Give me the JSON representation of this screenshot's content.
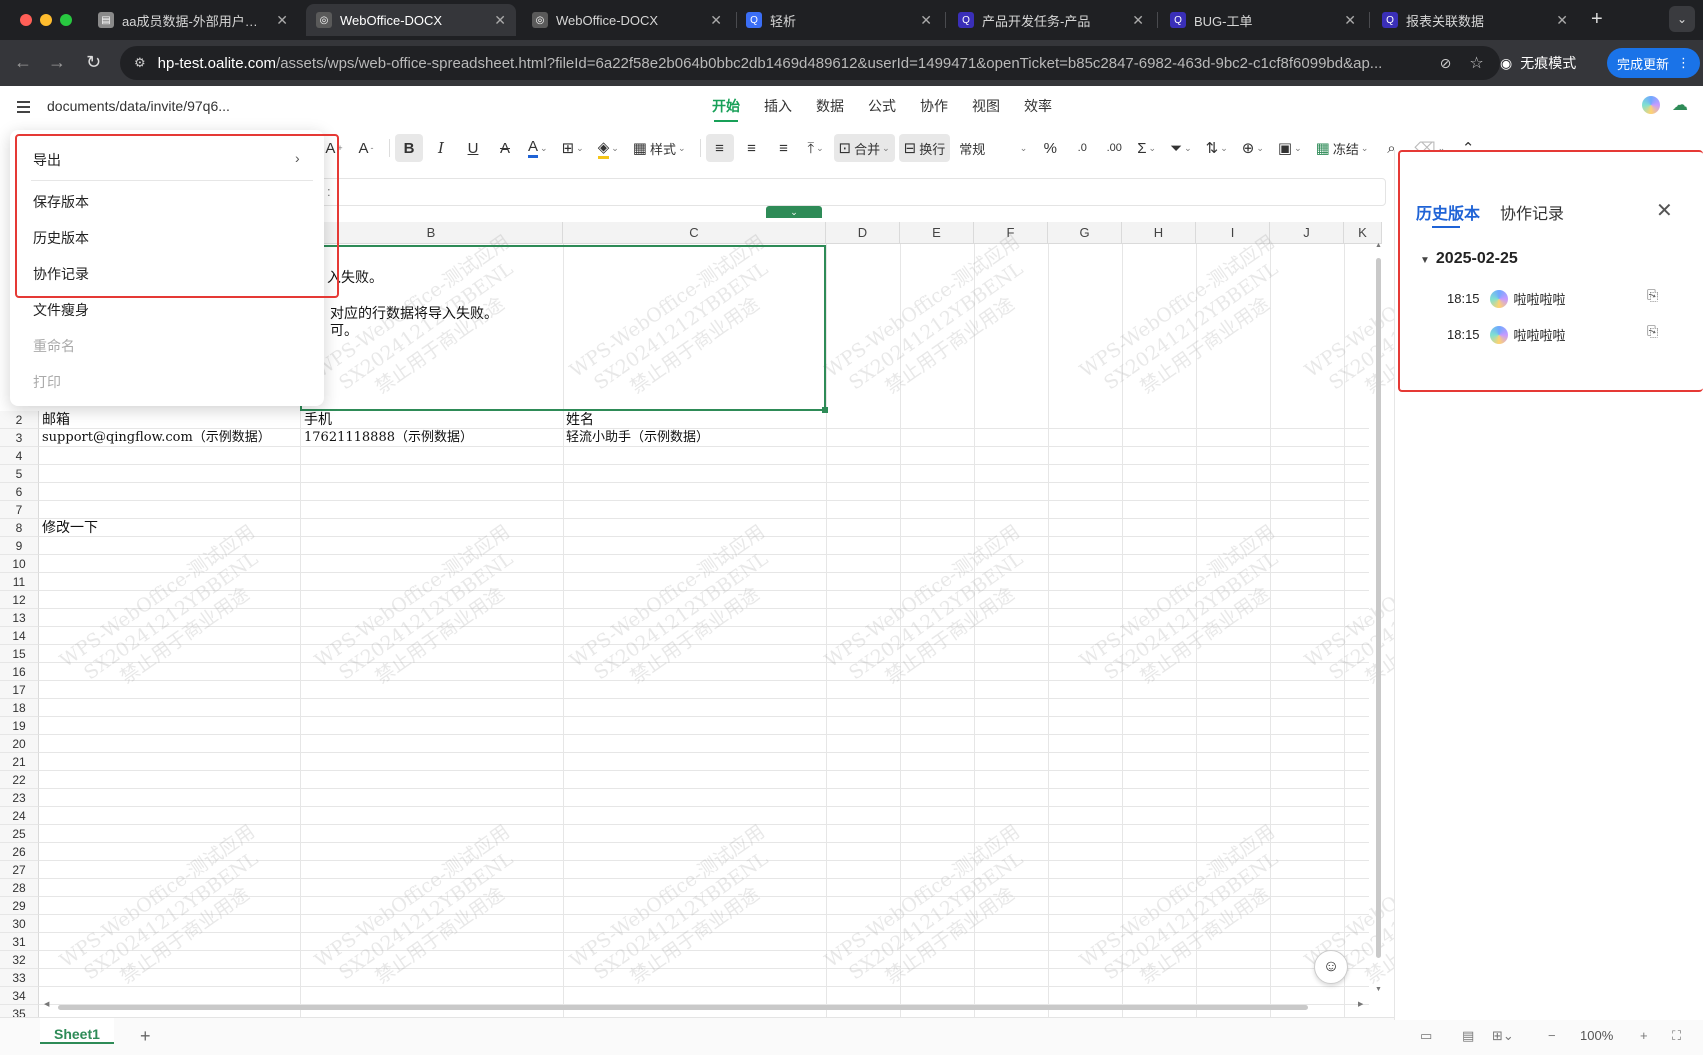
{
  "browser": {
    "tabs": [
      {
        "title": "aa成员数据-外部用户测试",
        "active": false,
        "icon": "doc-icon",
        "color": "#8a8a8a"
      },
      {
        "title": "WebOffice-DOCX",
        "active": true,
        "icon": "globe-icon",
        "color": "#5a5a5a"
      },
      {
        "title": "WebOffice-DOCX",
        "active": false,
        "icon": "globe-icon",
        "color": "#5a5a5a"
      },
      {
        "title": "轻析",
        "active": false,
        "icon": "qingxi-icon",
        "color": "#3b6ef5"
      },
      {
        "title": "产品开发任务-产品",
        "active": false,
        "icon": "qingflow-icon",
        "color": "#3a2fb8"
      },
      {
        "title": "BUG-工单",
        "active": false,
        "icon": "qingflow-icon",
        "color": "#3a2fb8"
      },
      {
        "title": "报表关联数据",
        "active": false,
        "icon": "qingflow-icon",
        "color": "#3a2fb8"
      }
    ],
    "url_host": "hp-test.oalite.com",
    "url_path": "/assets/wps/web-office-spreadsheet.html?fileId=6a22f58e2b064b0bbc2db1469d489612&userId=1499471&openTicket=b85c2847-6982-463d-9bc2-c1cf8f6099bd&ap...",
    "incognito_label": "无痕模式",
    "update_label": "完成更新"
  },
  "app": {
    "doc_path": "documents/data/invite/97q6...",
    "menu_tabs": [
      "开始",
      "插入",
      "数据",
      "公式",
      "协作",
      "视图",
      "效率"
    ],
    "active_tab": "开始"
  },
  "toolbar": {
    "style_label": "样式",
    "merge_label": "合并",
    "wrap_label": "换行",
    "number_format": "常规",
    "freeze_label": "冻结"
  },
  "formula_bar": {
    "text": ":"
  },
  "file_menu": {
    "items": [
      {
        "label": "导出",
        "has_submenu": true,
        "disabled": false
      },
      {
        "label": "保存版本",
        "disabled": false
      },
      {
        "label": "历史版本",
        "disabled": false
      },
      {
        "label": "协作记录",
        "disabled": false
      },
      {
        "label": "文件瘦身",
        "disabled": false
      },
      {
        "label": "重命名",
        "disabled": true
      },
      {
        "label": "打印",
        "disabled": true
      }
    ]
  },
  "sheet": {
    "columns": [
      "B",
      "C",
      "D",
      "E",
      "F",
      "G",
      "H",
      "I",
      "J",
      "K"
    ],
    "rows": [
      "2",
      "3",
      "4",
      "5",
      "6",
      "7",
      "8",
      "9",
      "10",
      "11",
      "12",
      "13",
      "14",
      "15",
      "16",
      "17",
      "18",
      "19",
      "20",
      "21",
      "22",
      "23",
      "24",
      "25",
      "26",
      "27",
      "28",
      "29",
      "30",
      "31",
      "32",
      "33",
      "34",
      "35"
    ],
    "merged_lines": [
      "入失败。",
      "对应的行数据将导入失败。",
      "可。"
    ],
    "cells": {
      "a2": "邮箱",
      "b2": "手机",
      "c2": "姓名",
      "a3": "support@qingflow.com（示例数据）",
      "b3": "17621118888（示例数据）",
      "c3": "轻流小助手（示例数据）",
      "a8": "修改一下"
    },
    "watermark_lines": [
      "WPS-WebOffice-测试应用",
      "SX20241212YBBENL",
      "禁止用于商业用途"
    ],
    "sheet_tab": "Sheet1",
    "zoom": "100%"
  },
  "history_panel": {
    "tab_history": "历史版本",
    "tab_collab": "协作记录",
    "date": "2025-02-25",
    "entries": [
      {
        "time": "18:15",
        "user": "啦啦啦啦"
      },
      {
        "time": "18:15",
        "user": "啦啦啦啦"
      }
    ]
  },
  "colors": {
    "accent_green": "#2e8b57",
    "highlight_red": "#e53935",
    "panel_blue": "#1f63d6"
  }
}
